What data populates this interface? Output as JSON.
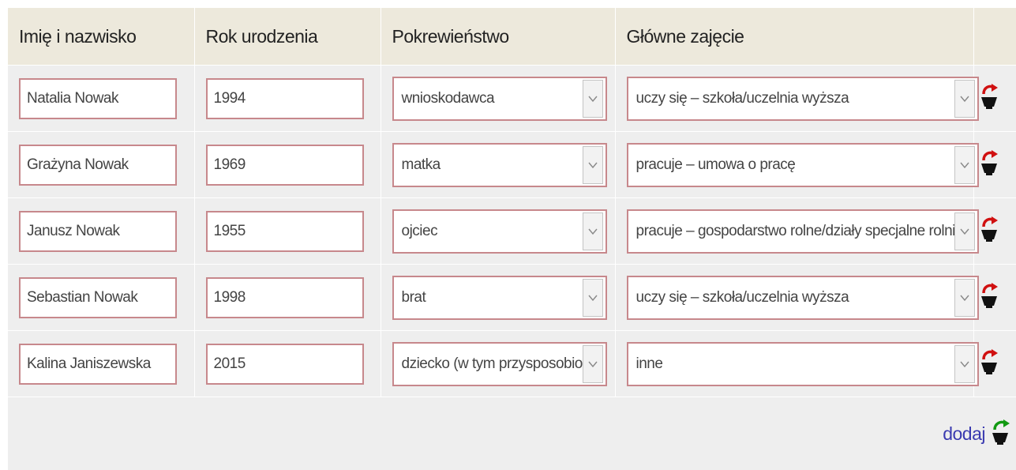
{
  "headers": {
    "name": "Imię i nazwisko",
    "year": "Rok urodzenia",
    "relation": "Pokrewieństwo",
    "occupation": "Główne zajęcie"
  },
  "rows": [
    {
      "name": "Natalia Nowak",
      "year": "1994",
      "relation": "wnioskodawca",
      "occupation": "uczy się – szkoła/uczelnia wyższa"
    },
    {
      "name": "Grażyna Nowak",
      "year": "1969",
      "relation": "matka",
      "occupation": "pracuje – umowa o pracę"
    },
    {
      "name": "Janusz Nowak",
      "year": "1955",
      "relation": "ojciec",
      "occupation": "pracuje – gospodarstwo rolne/działy specjalne rolnictwa"
    },
    {
      "name": "Sebastian Nowak",
      "year": "1998",
      "relation": "brat",
      "occupation": "uczy się – szkoła/uczelnia wyższa"
    },
    {
      "name": "Kalina Janiszewska",
      "year": "2015",
      "relation": "dziecko (w tym przysposobione)",
      "occupation": "inne"
    }
  ],
  "footer": {
    "add_label": "dodaj"
  },
  "icons": {
    "delete": "remove-person-icon",
    "add": "add-person-icon",
    "dropdown": "chevron-down-icon"
  },
  "colors": {
    "header_bg": "#ede9dc",
    "row_bg": "#eeeeee",
    "field_border": "#c7888c",
    "link": "#3a3ab0",
    "delete_arrow": "#d01010",
    "add_arrow": "#119911"
  }
}
